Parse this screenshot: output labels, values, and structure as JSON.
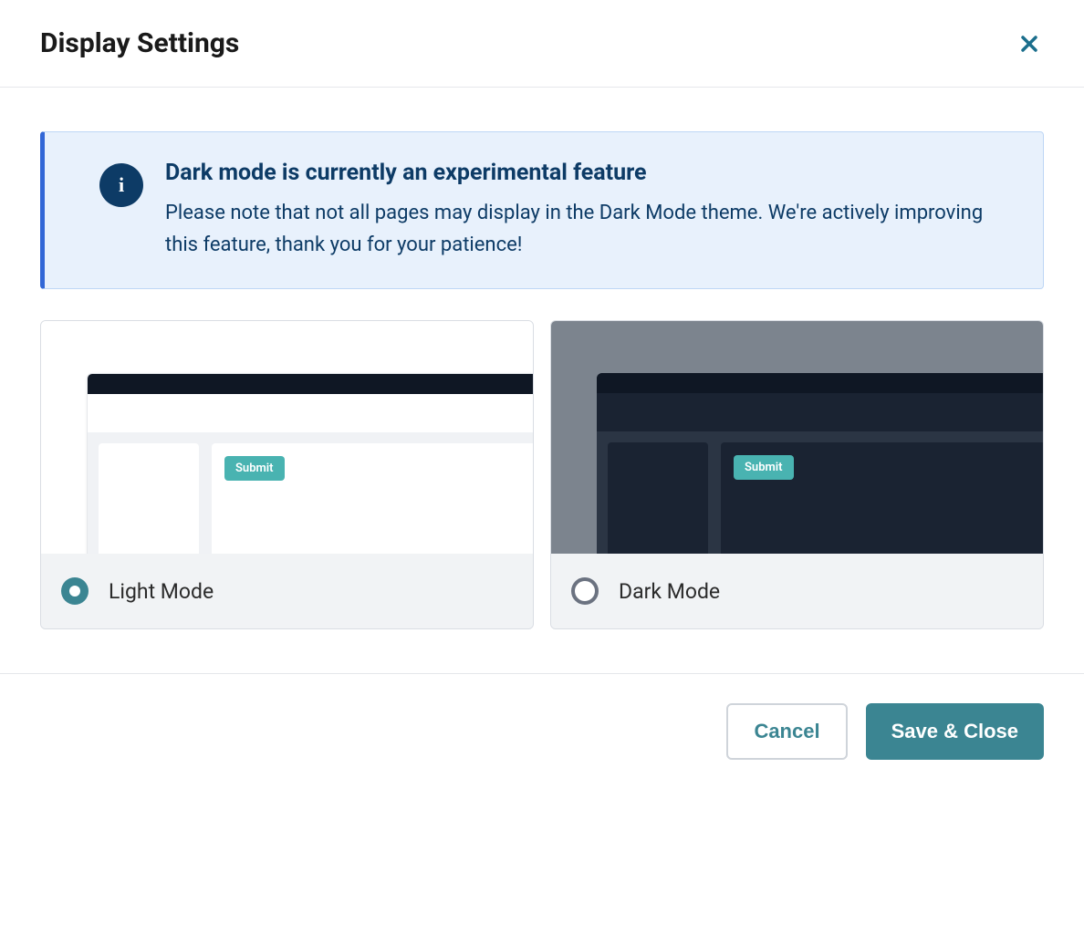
{
  "header": {
    "title": "Display Settings"
  },
  "banner": {
    "icon_glyph": "i",
    "heading": "Dark mode is currently an experimental feature",
    "text": "Please note that not all pages may display in the Dark Mode theme. We're actively improving this feature, thank you for your patience!"
  },
  "options": {
    "light": {
      "label": "Light Mode",
      "selected": true,
      "preview_button": "Submit"
    },
    "dark": {
      "label": "Dark Mode",
      "selected": false,
      "preview_button": "Submit"
    }
  },
  "footer": {
    "cancel": "Cancel",
    "save": "Save & Close"
  }
}
